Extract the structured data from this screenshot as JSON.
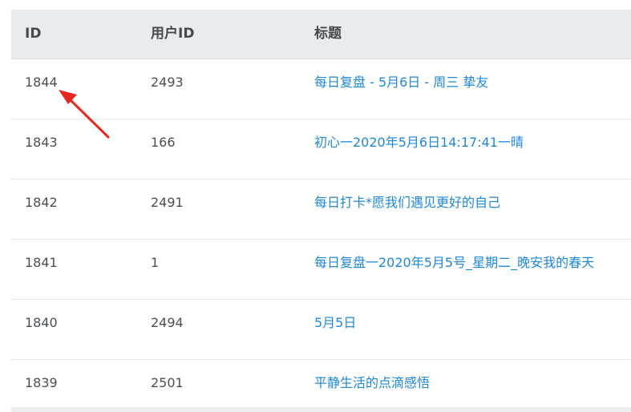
{
  "table": {
    "headers": {
      "id": "ID",
      "user_id": "用户ID",
      "title": "标题"
    },
    "rows": [
      {
        "id": "1844",
        "user_id": "2493",
        "title": "每日复盘 - 5月6日 - 周三 挚友"
      },
      {
        "id": "1843",
        "user_id": "166",
        "title": "初心一2020年5月6日14:17:41一晴"
      },
      {
        "id": "1842",
        "user_id": "2491",
        "title": "每日打卡*愿我们遇见更好的自己"
      },
      {
        "id": "1841",
        "user_id": "1",
        "title": "每日复盘一2020年5月5号_星期二_晚安我的春天"
      },
      {
        "id": "1840",
        "user_id": "2494",
        "title": "5月5日"
      },
      {
        "id": "1839",
        "user_id": "2501",
        "title": "平静生活的点滴感悟"
      }
    ]
  },
  "annotation": {
    "color": "#e8281f"
  }
}
